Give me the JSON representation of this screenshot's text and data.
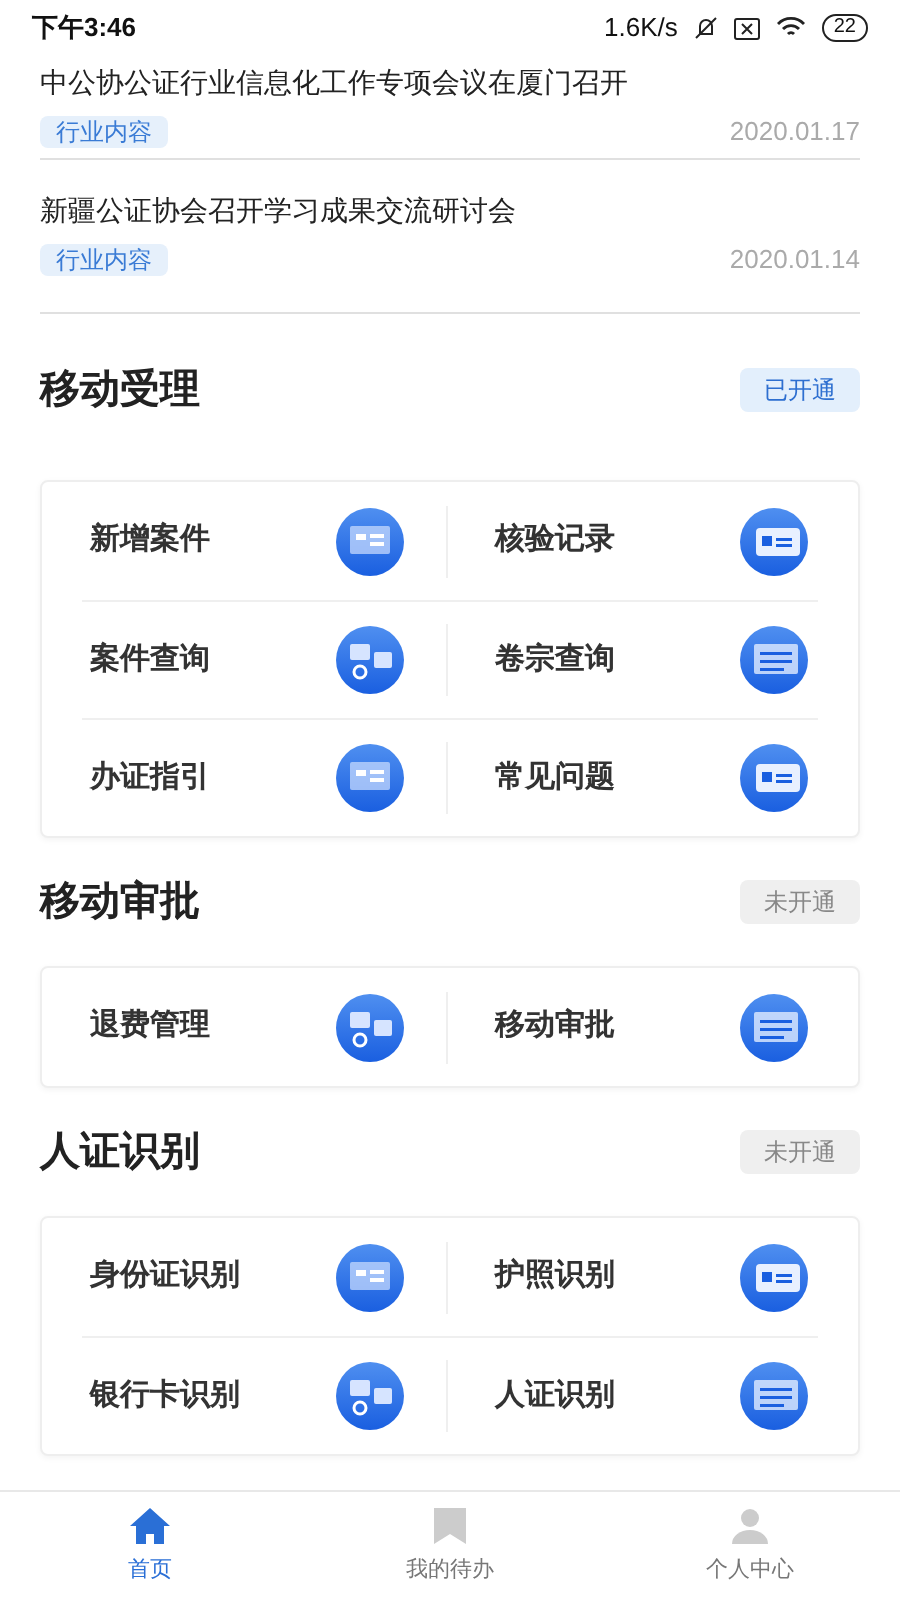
{
  "status_bar": {
    "time": "下午3:46",
    "speed": "1.6K/s",
    "battery": "22"
  },
  "news": [
    {
      "title": "中公协公证行业信息化工作专项会议在厦门召开",
      "tag": "行业内容",
      "date": "2020.01.17"
    },
    {
      "title": "新疆公证协会召开学习成果交流研讨会",
      "tag": "行业内容",
      "date": "2020.01.14"
    }
  ],
  "sections": [
    {
      "title": "移动受理",
      "status": "已开通",
      "enabled": true,
      "items": [
        "新增案件",
        "核验记录",
        "案件查询",
        "卷宗查询",
        "办证指引",
        "常见问题"
      ]
    },
    {
      "title": "移动审批",
      "status": "未开通",
      "enabled": false,
      "items": [
        "退费管理",
        "移动审批"
      ]
    },
    {
      "title": "人证识别",
      "status": "未开通",
      "enabled": false,
      "items": [
        "身份证识别",
        "护照识别",
        "银行卡识别",
        "人证识别"
      ]
    }
  ],
  "nav": [
    {
      "label": "首页",
      "selected": true
    },
    {
      "label": "我的待办",
      "selected": false
    },
    {
      "label": "个人中心",
      "selected": false
    }
  ]
}
